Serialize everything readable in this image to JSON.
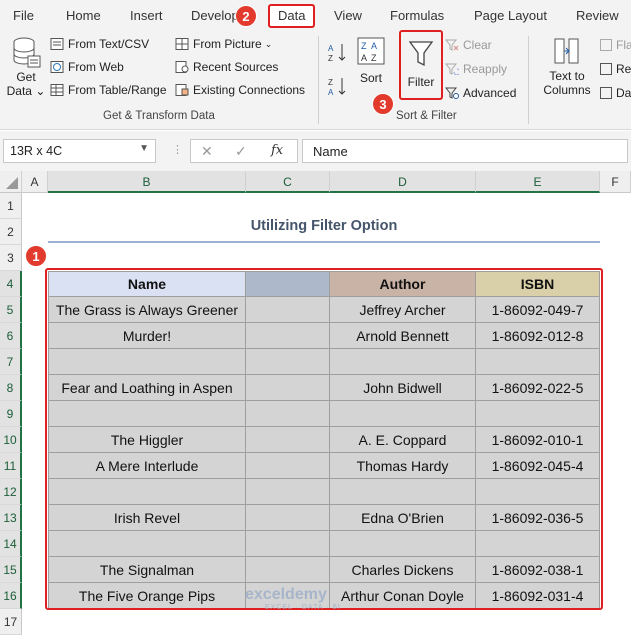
{
  "ribbon": {
    "tabs": [
      {
        "label": "File"
      },
      {
        "label": "Home"
      },
      {
        "label": "Insert"
      },
      {
        "label": "Develop"
      },
      {
        "label": "Data"
      },
      {
        "label": "View"
      },
      {
        "label": "Formulas"
      },
      {
        "label": "Page Layout"
      },
      {
        "label": "Review"
      }
    ],
    "get_data": {
      "line1": "Get",
      "line2": "Data"
    },
    "get_transform": [
      {
        "label": "From Text/CSV"
      },
      {
        "label": "From Web"
      },
      {
        "label": "From Table/Range"
      }
    ],
    "picture_sources": [
      {
        "label": "From Picture"
      },
      {
        "label": "Recent Sources"
      },
      {
        "label": "Existing Connections"
      }
    ],
    "group_get_transform": "Get & Transform Data",
    "sort_label": "Sort",
    "filter_label": "Filter",
    "clear_label": "Clear",
    "reapply_label": "Reapply",
    "advanced_label": "Advanced",
    "group_sort_filter": "Sort & Filter",
    "text_to_columns": {
      "line1": "Text to",
      "line2": "Columns"
    },
    "partial": {
      "fl": "Fla",
      "re": "Re",
      "da": "Da"
    }
  },
  "badges": {
    "b1": "1",
    "b2": "2",
    "b3": "3"
  },
  "formula_bar": {
    "name_box": "13R x 4C",
    "cancel": "✕",
    "enter": "✓",
    "fx": "fx",
    "formula": "Name"
  },
  "columns": [
    "A",
    "B",
    "C",
    "D",
    "E",
    "F"
  ],
  "rows": [
    "1",
    "2",
    "3",
    "4",
    "5",
    "6",
    "7",
    "8",
    "9",
    "10",
    "11",
    "12",
    "13",
    "14",
    "15",
    "16",
    "17"
  ],
  "sheet": {
    "title": "Utilizing Filter Option",
    "headers": {
      "name": "Name",
      "c": "",
      "author": "Author",
      "isbn": "ISBN"
    },
    "data": [
      {
        "name": "The Grass is Always Greener",
        "author": "Jeffrey Archer",
        "isbn": "1-86092-049-7"
      },
      {
        "name": "Murder!",
        "author": "Arnold Bennett",
        "isbn": "1-86092-012-8"
      },
      {
        "name": "",
        "author": "",
        "isbn": ""
      },
      {
        "name": "Fear and Loathing in Aspen",
        "author": "John Bidwell",
        "isbn": "1-86092-022-5"
      },
      {
        "name": "",
        "author": "",
        "isbn": ""
      },
      {
        "name": "The Higgler",
        "author": "A. E. Coppard",
        "isbn": "1-86092-010-1"
      },
      {
        "name": "A Mere Interlude",
        "author": "Thomas Hardy",
        "isbn": "1-86092-045-4"
      },
      {
        "name": "",
        "author": "",
        "isbn": ""
      },
      {
        "name": "Irish Revel",
        "author": "Edna O'Brien",
        "isbn": "1-86092-036-5"
      },
      {
        "name": "",
        "author": "",
        "isbn": ""
      },
      {
        "name": "The Signalman",
        "author": "Charles Dickens",
        "isbn": "1-86092-038-1"
      },
      {
        "name": "The Five Orange Pips",
        "author": "Arthur Conan Doyle",
        "isbn": "1-86092-031-4"
      }
    ]
  },
  "watermark": {
    "name": "exceldemy",
    "tagline": "EXCEL · DATA · BI"
  },
  "colors": {
    "accent_red": "#e02020",
    "badge_red": "#e23b2e",
    "header_name": "#d9e1f2",
    "header_c": "#adb9ca",
    "header_author": "#c9b2a6",
    "header_isbn": "#d9cfa8",
    "selection_green": "#217346"
  }
}
